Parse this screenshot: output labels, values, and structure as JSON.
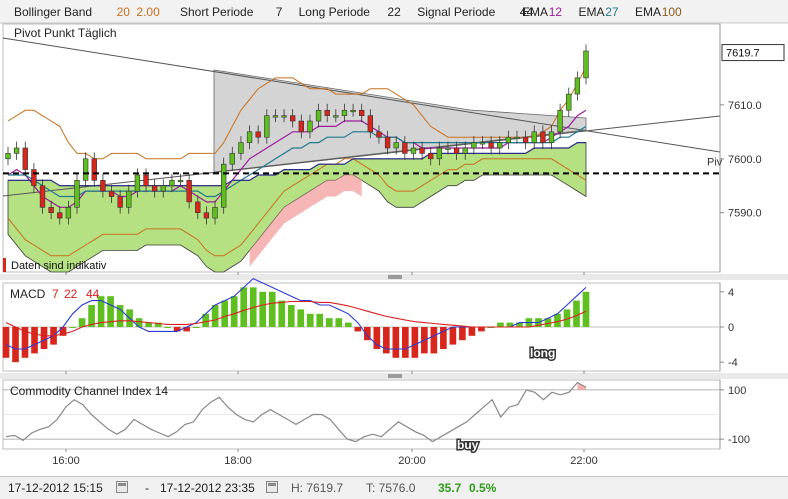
{
  "header": {
    "bollinger": {
      "label": "Bollinger Band",
      "p1": "20",
      "p2": "2.00"
    },
    "short": {
      "label": "Short Periode",
      "value": "7"
    },
    "long": {
      "label": "Long Periode",
      "value": "22"
    },
    "signal": {
      "label": "Signal Periode",
      "value": "44"
    },
    "ema1": {
      "label": "EMA",
      "value": "12"
    },
    "ema2": {
      "label": "EMA",
      "value": "27"
    },
    "ema3": {
      "label": "EMA",
      "value": "100"
    }
  },
  "main_panel": {
    "pivot_label": "Pivot Punkt  Täglich",
    "disclaimer": "Daten sind indikativ",
    "piv_label": "Piv",
    "last_price": "7619.7"
  },
  "macd_panel": {
    "label": "MACD",
    "p1": "7",
    "p2": "22",
    "p3": "44",
    "signal_text": "long"
  },
  "cci_panel": {
    "label": "Commodity Channel Index",
    "period": "14",
    "signal_text": "buy"
  },
  "footer": {
    "from": "17-12-2012 15:15",
    "dash": "-",
    "to": "17-12-2012 23:35",
    "high": "H: 7619.7",
    "low": "T: 7576.0",
    "change": "35.7",
    "change_pct": "0.5%"
  },
  "colors": {
    "ema12": "#9b1c9b",
    "ema27": "#1f7a8c",
    "bollinger": "#c8701e",
    "up": "#5fbf1f",
    "down": "#d9261c",
    "cloud": "#a8dc6c",
    "cloud_red": "#f4a4a4",
    "macd_line": "#2b3bd1",
    "signal_line": "#d92020",
    "cci_line": "#888888",
    "cci_fill_up": "#f4a8a8",
    "cci_fill_down": "#a8dc6c"
  },
  "chart_data": [
    {
      "type": "candlestick",
      "title": "",
      "xlabel": "",
      "ylabel": "",
      "x_ticks": [
        "16:00",
        "18:00",
        "20:00",
        "22:00"
      ],
      "y_ticks": [
        7590.0,
        7600.0,
        7610.0
      ],
      "ylim": [
        7579,
        7625
      ],
      "pivot_level": 7597.3,
      "last_price": 7619.7,
      "close": [
        7601,
        7602,
        7598,
        7595,
        7591,
        7590,
        7589,
        7591,
        7596,
        7600,
        7596,
        7594,
        7593,
        7591,
        7594,
        7597,
        7595,
        7594,
        7595,
        7596,
        7596,
        7592,
        7590,
        7589,
        7591,
        7599,
        7601,
        7603,
        7605,
        7604,
        7608,
        7608,
        7608,
        7607,
        7605,
        7607,
        7609,
        7608,
        7608,
        7609,
        7609,
        7608,
        7605,
        7604,
        7602,
        7603,
        7601,
        7602,
        7601,
        7600,
        7602,
        7602,
        7601,
        7602,
        7603,
        7603,
        7602,
        7603,
        7604,
        7604,
        7603,
        7605,
        7603,
        7605,
        7609,
        7612,
        7615,
        7620
      ],
      "series": [
        {
          "name": "EMA 12",
          "values": [
            7597,
            7598,
            7597,
            7595,
            7593,
            7592,
            7591,
            7591,
            7592,
            7594,
            7594,
            7594,
            7594,
            7593,
            7593,
            7594,
            7594,
            7594,
            7594,
            7594,
            7595,
            7594,
            7593,
            7592,
            7592,
            7594,
            7596,
            7598,
            7600,
            7601,
            7602,
            7603,
            7604,
            7605,
            7605,
            7605,
            7606,
            7606,
            7606,
            7607,
            7607,
            7607,
            7606,
            7605,
            7604,
            7604,
            7603,
            7603,
            7602,
            7602,
            7602,
            7602,
            7602,
            7602,
            7602,
            7602,
            7602,
            7602,
            7603,
            7603,
            7603,
            7603,
            7603,
            7604,
            7605,
            7606,
            7608,
            7609
          ]
        },
        {
          "name": "EMA 27",
          "values": [
            7597,
            7597,
            7597,
            7596,
            7595,
            7594,
            7593,
            7593,
            7593,
            7594,
            7594,
            7594,
            7594,
            7594,
            7594,
            7594,
            7594,
            7594,
            7594,
            7594,
            7594,
            7594,
            7594,
            7593,
            7593,
            7594,
            7595,
            7596,
            7597,
            7598,
            7599,
            7600,
            7601,
            7602,
            7602,
            7603,
            7603,
            7604,
            7604,
            7604,
            7605,
            7605,
            7605,
            7604,
            7604,
            7604,
            7603,
            7603,
            7603,
            7603,
            7603,
            7603,
            7603,
            7603,
            7603,
            7603,
            7603,
            7603,
            7603,
            7603,
            7603,
            7603,
            7603,
            7603,
            7604,
            7604,
            7605,
            7606
          ]
        },
        {
          "name": "EMA 100",
          "values": [
            7596,
            7596,
            7596,
            7596,
            7596,
            7596,
            7595,
            7595,
            7595,
            7595,
            7595,
            7595,
            7595,
            7595,
            7595,
            7595,
            7595,
            7595,
            7595,
            7595,
            7595,
            7595,
            7595,
            7595,
            7595,
            7595,
            7596,
            7596,
            7596,
            7597,
            7597,
            7597,
            7598,
            7598,
            7598,
            7598,
            7599,
            7599,
            7599,
            7599,
            7600,
            7600,
            7600,
            7600,
            7600,
            7600,
            7600,
            7600,
            7600,
            7601,
            7601,
            7601,
            7601,
            7601,
            7601,
            7601,
            7601,
            7601,
            7601,
            7601,
            7601,
            7602,
            7602,
            7602,
            7602,
            7602,
            7603,
            7603
          ]
        },
        {
          "name": "Bollinger Upper",
          "values": [
            7607,
            7608,
            7609,
            7609,
            7608,
            7607,
            7606,
            7603,
            7601,
            7601,
            7600,
            7600,
            7601,
            7601,
            7601,
            7601,
            7600,
            7600,
            7600,
            7600,
            7600,
            7601,
            7601,
            7601,
            7601,
            7603,
            7606,
            7609,
            7611,
            7613,
            7614,
            7615,
            7615,
            7615,
            7614,
            7613,
            7613,
            7613,
            7612,
            7612,
            7612,
            7612,
            7613,
            7613,
            7613,
            7612,
            7611,
            7610,
            7608,
            7606,
            7605,
            7604,
            7604,
            7604,
            7604,
            7604,
            7604,
            7604,
            7604,
            7604,
            7604,
            7604,
            7605,
            7606,
            7609,
            7611,
            7614,
            7617
          ]
        },
        {
          "name": "Bollinger Lower",
          "values": [
            7589,
            7587,
            7585,
            7584,
            7583,
            7582,
            7582,
            7582,
            7583,
            7584,
            7585,
            7586,
            7586,
            7586,
            7586,
            7586,
            7587,
            7587,
            7587,
            7587,
            7587,
            7586,
            7585,
            7583,
            7582,
            7582,
            7583,
            7584,
            7586,
            7588,
            7590,
            7592,
            7594,
            7595,
            7596,
            7597,
            7598,
            7599,
            7599,
            7600,
            7600,
            7599,
            7598,
            7597,
            7595,
            7594,
            7594,
            7594,
            7595,
            7596,
            7597,
            7598,
            7598,
            7599,
            7599,
            7600,
            7600,
            7600,
            7600,
            7600,
            7600,
            7600,
            7600,
            7600,
            7599,
            7598,
            7597,
            7596
          ]
        }
      ]
    },
    {
      "type": "bar",
      "title": "",
      "ylim": [
        -5,
        5
      ],
      "y_ticks": [
        4,
        0,
        -4
      ],
      "histogram": [
        -3.5,
        -4,
        -3.5,
        -3,
        -2.5,
        -2,
        -1,
        0,
        1,
        2.5,
        3.5,
        3.5,
        2.5,
        2,
        1,
        0.5,
        0.5,
        0,
        -0.5,
        -0.5,
        0,
        1.5,
        2.5,
        3,
        3.5,
        4.5,
        4.5,
        4,
        4,
        3,
        2.5,
        2,
        1.5,
        1.5,
        1,
        1,
        0.5,
        -0.5,
        -1.5,
        -2.5,
        -3,
        -3.5,
        -3.5,
        -3.5,
        -3,
        -3,
        -2.5,
        -2,
        -1.5,
        -1,
        -0.5,
        0,
        0.5,
        0.5,
        0.5,
        1,
        1,
        1,
        1.5,
        2,
        3,
        4
      ],
      "series": [
        {
          "name": "MACD",
          "values": [
            -2,
            -2.5,
            -2.5,
            -2,
            -1.5,
            -1,
            0,
            1.5,
            2.5,
            3,
            3,
            2.5,
            2,
            1,
            0,
            -0.5,
            -0.5,
            -0.5,
            -0.5,
            0,
            0.5,
            1.5,
            2.5,
            3,
            3.5,
            4.5,
            5.5,
            5,
            4.5,
            4,
            3.5,
            3,
            3,
            2.5,
            2.5,
            2,
            1.5,
            0.5,
            -1,
            -2,
            -2.5,
            -2.5,
            -2.5,
            -2,
            -1.5,
            -1,
            -0.5,
            0,
            0,
            0,
            0,
            0,
            0,
            0,
            0.5,
            0.5,
            0.5,
            1,
            1.5,
            2.5,
            3.5,
            4.5
          ]
        },
        {
          "name": "Signal",
          "values": [
            0.5,
            0,
            -0.5,
            -0.8,
            -1,
            -1,
            -0.8,
            -0.5,
            0,
            0.3,
            0.5,
            0.6,
            0.7,
            0.7,
            0.6,
            0.5,
            0.4,
            0.3,
            0.3,
            0.3,
            0.4,
            0.6,
            0.8,
            1.2,
            1.5,
            1.9,
            2.2,
            2.5,
            2.7,
            2.8,
            2.9,
            2.9,
            2.9,
            2.8,
            2.8,
            2.6,
            2.4,
            2.1,
            1.8,
            1.5,
            1.2,
            1,
            0.8,
            0.6,
            0.5,
            0.4,
            0.3,
            0.2,
            0.1,
            0,
            0,
            0,
            0,
            0,
            0,
            0,
            0.2,
            0.4,
            0.6,
            0.9,
            1.3,
            1.8
          ]
        }
      ]
    },
    {
      "type": "line",
      "title": "",
      "ylim": [
        -140,
        140
      ],
      "y_ticks": [
        100,
        -100
      ],
      "series": [
        {
          "name": "CCI 14",
          "values": [
            -90,
            -85,
            -105,
            -75,
            -60,
            -50,
            -20,
            30,
            60,
            40,
            0,
            -30,
            -60,
            -80,
            -60,
            -20,
            -40,
            -60,
            -75,
            -90,
            -70,
            -40,
            -30,
            20,
            50,
            70,
            30,
            0,
            -20,
            -30,
            0,
            20,
            0,
            -20,
            -40,
            -20,
            0,
            0,
            -20,
            -60,
            -100,
            -110,
            -90,
            -80,
            -90,
            -60,
            -30,
            -50,
            -70,
            -85,
            -110,
            -90,
            -70,
            -50,
            -30,
            0,
            30,
            60,
            -10,
            30,
            40,
            100,
            90,
            60,
            90,
            80,
            90,
            130,
            110
          ]
        }
      ]
    }
  ]
}
